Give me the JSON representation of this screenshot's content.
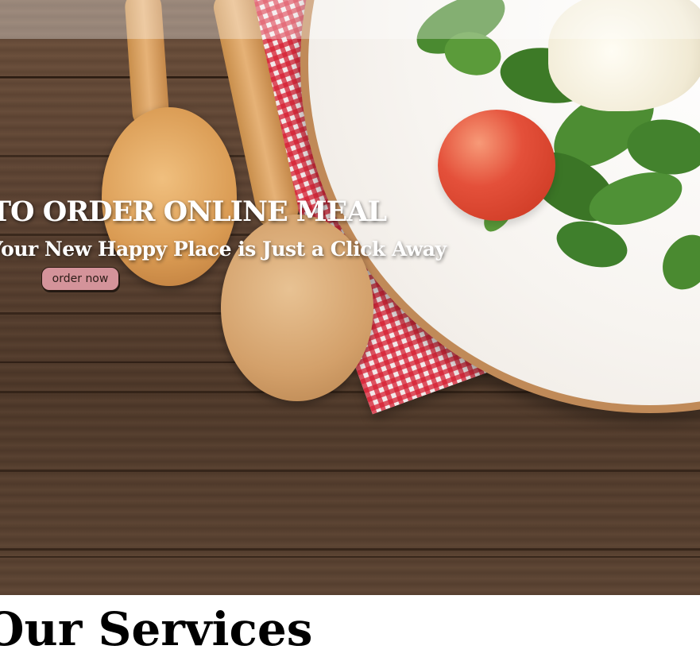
{
  "hero": {
    "title": "TO ORDER ONLINE MEAL",
    "subtitle": "Your New Happy Place is Just a Click Away",
    "order_button_label": "order now"
  },
  "services": {
    "heading": "Our Services"
  },
  "colors": {
    "button_bg": "#d4939a",
    "hero_text": "#ffffff",
    "wood": "#5a4131",
    "napkin_red": "#d61f32"
  }
}
